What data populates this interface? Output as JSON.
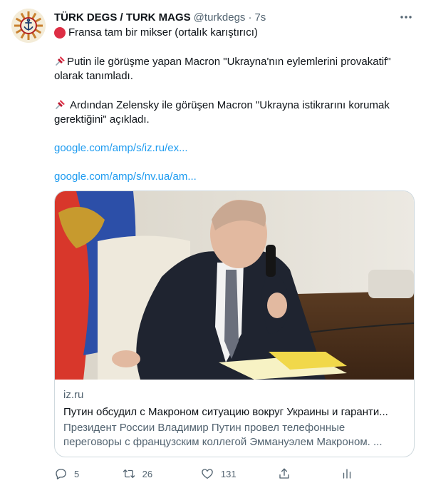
{
  "tweet": {
    "author_name": "TÜRK DEGS / TURK MAGS",
    "author_handle": "@turkdegs",
    "separator": "·",
    "time": "7s",
    "line1": "Fransa tam bir mikser (ortalık karıştırıcı)",
    "para2_line1": "Putin ile görüşme yapan Macron \"Ukrayna'nın eylemlerini provakatif\"",
    "para2_line2": "olarak tanımladı.",
    "para3_line1": "Ardından Zelensky ile görüşen Macron \"Ukrayna istikrarını korumak",
    "para3_line2": "gerektiğini\" açıkladı.",
    "link1": "google.com/amp/s/iz.ru/ex...",
    "link2": "google.com/amp/s/nv.ua/am..."
  },
  "card": {
    "domain": "iz.ru",
    "title": "Путин обсудил с Макроном ситуацию вокруг Украины и гаранти...",
    "desc_line1": "Президент России Владимир Путин провел телефонные",
    "desc_line2": "переговоры с французским коллегой Эммануэлем Макроном. ..."
  },
  "actions": {
    "replies": "5",
    "retweets": "26",
    "likes": "131"
  },
  "icons": {
    "red_circle": "red-circle-emoji",
    "pushpin": "pushpin-emoji",
    "reply": "reply-icon",
    "retweet": "retweet-icon",
    "like": "heart-icon",
    "share": "share-icon",
    "analytics": "analytics-icon",
    "more": "more-icon"
  },
  "colors": {
    "link": "#1d9bf0",
    "secondary_text": "#536471",
    "primary_text": "#0f1419",
    "border": "#cfd9de"
  }
}
